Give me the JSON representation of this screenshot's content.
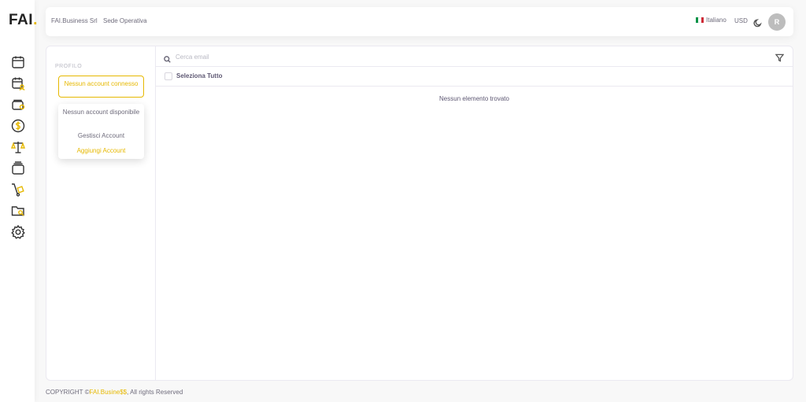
{
  "logo": {
    "text": "FAI",
    "dot": "."
  },
  "sidebar": {
    "icons": [
      {
        "name": "calendar-icon"
      },
      {
        "name": "calendar-user-icon"
      },
      {
        "name": "wallet-icon"
      },
      {
        "name": "dollar-coin-icon"
      },
      {
        "name": "scale-icon"
      },
      {
        "name": "layers-icon"
      },
      {
        "name": "hand-truck-icon"
      },
      {
        "name": "folder-search-icon"
      },
      {
        "name": "gear-icon"
      }
    ]
  },
  "header": {
    "company": "FAI.Business Srl",
    "site": "Sede Operativa",
    "language": "Italiano",
    "currency": "USD",
    "avatar_initial": "R"
  },
  "profile": {
    "label": "PROFILO",
    "account_button": "Nessun account connesso",
    "dropdown": {
      "none_available": "Nessun account disponibile",
      "manage": "Gestisci Account",
      "add": "Aggiungi Account"
    }
  },
  "list": {
    "search_placeholder": "Cerca email",
    "select_all": "Seleziona Tutto",
    "empty_message": "Nessun elemento trovato"
  },
  "footer": {
    "prefix": "COPYRIGHT ©",
    "brand": "FAI.Busine$$",
    "suffix": ", All rights Reserved"
  },
  "colors": {
    "accent": "#e6b800",
    "flag": [
      "#009246",
      "#ffffff",
      "#ce2b37"
    ]
  }
}
